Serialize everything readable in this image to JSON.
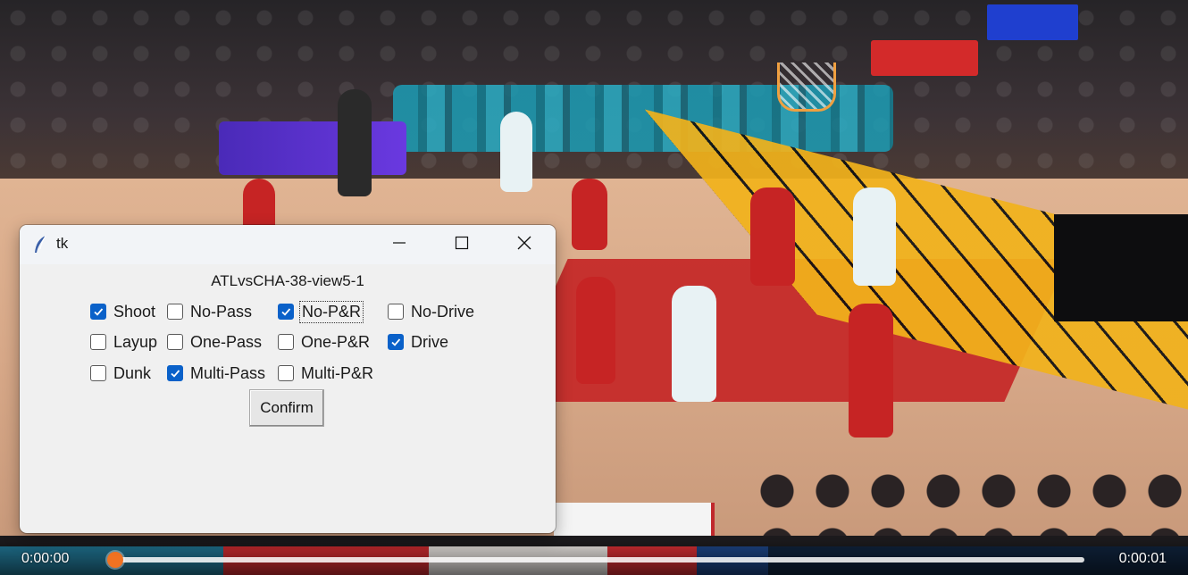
{
  "video": {
    "time_current": "0:00:00",
    "time_total": "0:00:01",
    "progress": 0.0,
    "accent_color": "#f07222"
  },
  "window": {
    "app_title": "tk",
    "app_icon": "feather-icon",
    "clip_label": "ATLvsCHA-38-view5-1",
    "controls": {
      "minimize_icon": "minimize-icon",
      "maximize_icon": "maximize-icon",
      "close_icon": "close-icon"
    },
    "checkboxes": [
      {
        "label": "Shoot",
        "checked": true
      },
      {
        "label": "No-Pass",
        "checked": false
      },
      {
        "label": "No-P&R",
        "checked": true,
        "focused": true
      },
      {
        "label": "No-Drive",
        "checked": false
      },
      {
        "label": "Layup",
        "checked": false
      },
      {
        "label": "One-Pass",
        "checked": false
      },
      {
        "label": "One-P&R",
        "checked": false
      },
      {
        "label": "Drive",
        "checked": true
      },
      {
        "label": "Dunk",
        "checked": false
      },
      {
        "label": "Multi-Pass",
        "checked": true
      },
      {
        "label": "Multi-P&R",
        "checked": false
      }
    ],
    "confirm_label": "Confirm",
    "check_color": "#0a61c9"
  }
}
